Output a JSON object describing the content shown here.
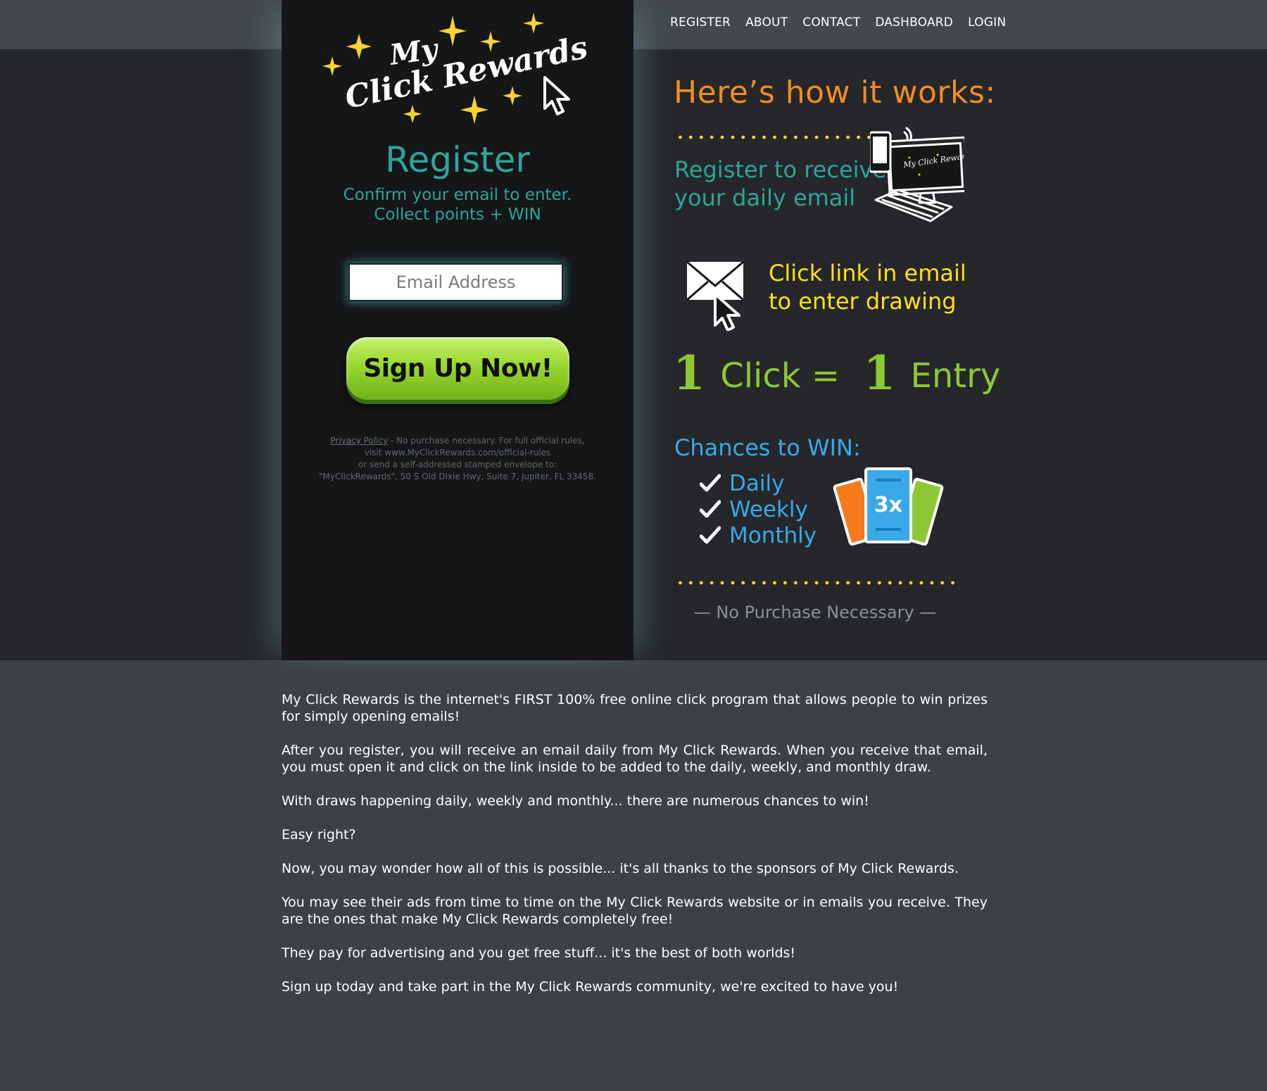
{
  "nav": {
    "items": [
      "REGISTER",
      "ABOUT",
      "CONTACT",
      "DASHBOARD",
      "LOGIN"
    ]
  },
  "logo": {
    "line1": "My",
    "line2": "Click Rewards"
  },
  "register": {
    "title": "Register",
    "subtitle_line1": "Confirm your email to enter.",
    "subtitle_line2": "Collect points + WIN",
    "email_placeholder": "Email Address",
    "signup_label": "Sign Up Now!"
  },
  "legal": {
    "privacy_link": "Privacy Policy",
    "line1_rest": " - No purchase necessary. For full official rules,",
    "line2": "visit www.MyClickRewards.com/official-rules",
    "line3": "or send a self-addressed stamped envelope to:",
    "line4": "\"MyClickRewards\", 50 S Old Dixie Hwy, Suite 7, Jupiter, FL 33458."
  },
  "how": {
    "title": "Here’s how it works:",
    "step1_line1": "Register to receive",
    "step1_line2": "your daily email",
    "screen_logo_text": "My Click Rewards",
    "step2_line1": "Click link in email",
    "step2_line2": "to enter drawing",
    "click_num1": "1",
    "click_word": "Click =",
    "click_num2": "1",
    "entry_word": "Entry",
    "chances_title": "Chances to WIN:",
    "chances": [
      "Daily",
      "Weekly",
      "Monthly"
    ],
    "ticket_label": "3x",
    "no_purchase": "— No Purchase Necessary —"
  },
  "colors": {
    "orange": "#f18d22",
    "teal": "#2fa49a",
    "yellow": "#ffe01b",
    "green": "#8dc834",
    "blue": "#3aa9e8"
  },
  "content": {
    "paragraphs": [
      "My Click Rewards is the internet's FIRST 100% free online click program that allows people to win prizes for simply opening emails!",
      "After you register, you will receive an email daily from My Click Rewards. When you receive that email, you must open it and click on the link inside to be added to the daily, weekly, and monthly draw.",
      "With draws happening daily, weekly and monthly... there are numerous chances to win!",
      "Easy right?",
      "Now, you may wonder how all of this is possible... it's all thanks to the sponsors of My Click Rewards.",
      "You may see their ads from time to time on the My Click Rewards website or in emails you receive. They are the ones that make My Click Rewards completely free!",
      "They pay for advertising and you get free stuff... it's the best of both worlds!",
      "Sign up today and take part in the My Click Rewards community, we're excited to have you!"
    ]
  }
}
